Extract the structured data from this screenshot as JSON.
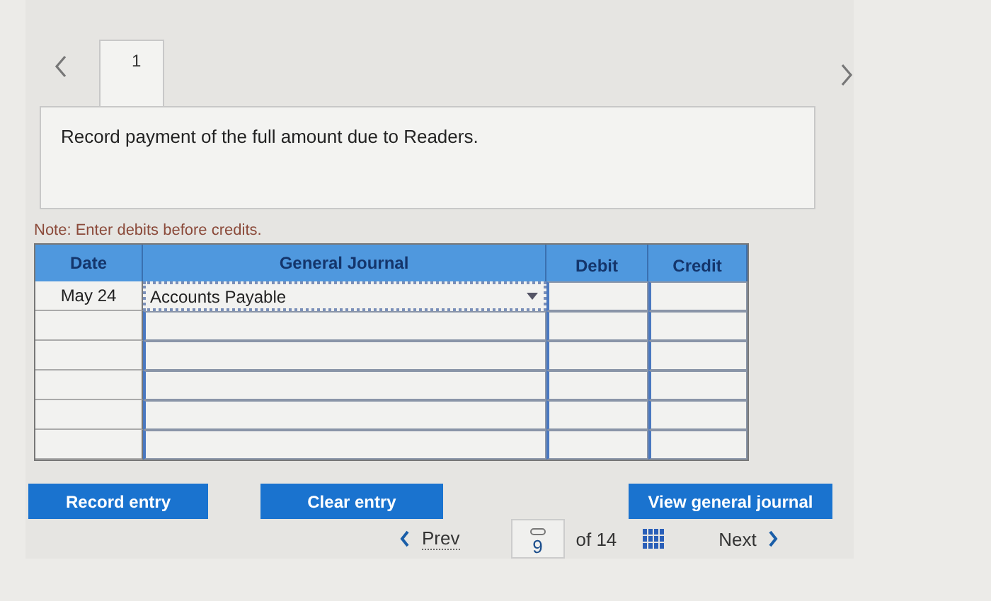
{
  "tabs": [
    {
      "label": "1",
      "selected": true
    }
  ],
  "prompt": "Record payment of the full amount due to Readers.",
  "note": "Note: Enter debits before credits.",
  "table": {
    "columns": [
      "Date",
      "General Journal",
      "Debit",
      "Credit"
    ],
    "rows": [
      {
        "date": "May 24",
        "account": "Accounts Payable"
      },
      {},
      {},
      {},
      {},
      {}
    ]
  },
  "buttons": [
    "Record entry",
    "Clear entry",
    "View general journal"
  ],
  "pager": {
    "prev": "Prev",
    "page": "9",
    "of": "of 14",
    "next": "Next"
  }
}
